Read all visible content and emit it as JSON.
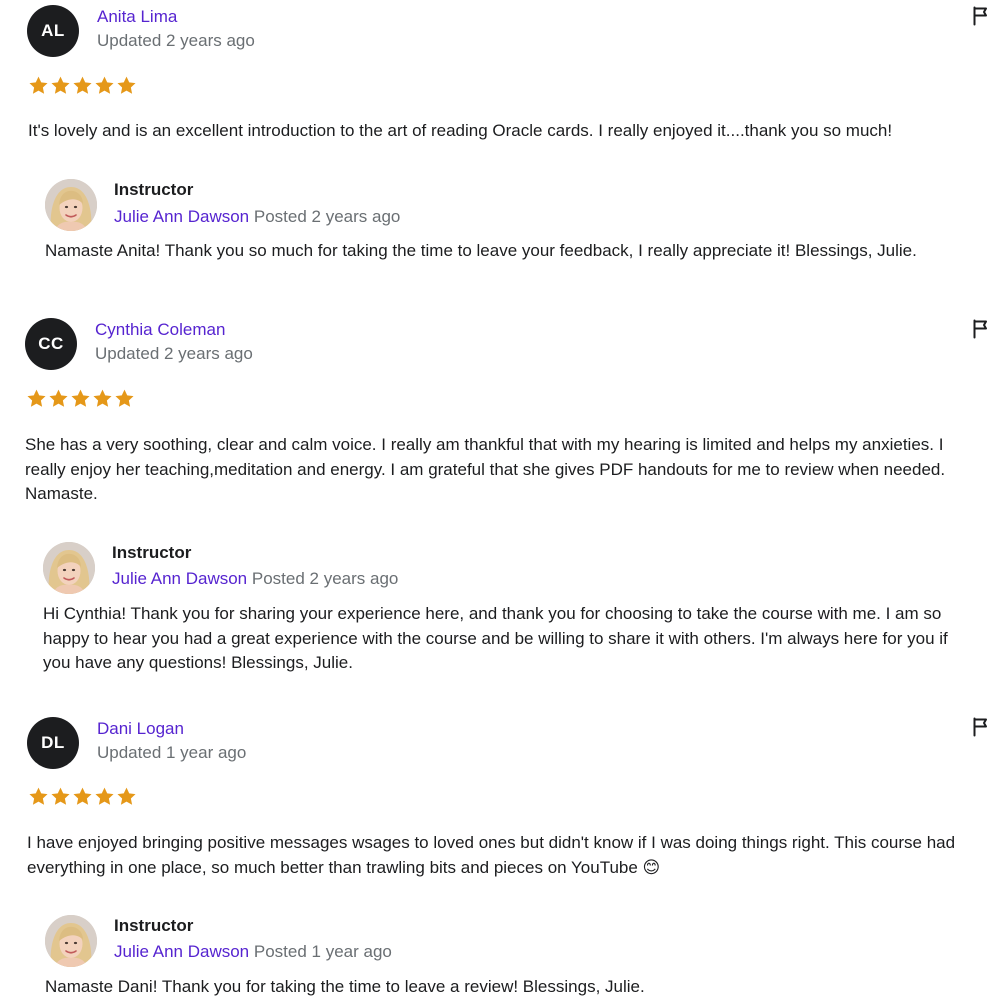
{
  "colors": {
    "accent": "#5624d0",
    "star": "#e59819",
    "muted": "#6a6f73",
    "text": "#1c1d1f"
  },
  "reviews": [
    {
      "initials": "AL",
      "name": "Anita Lima",
      "updated": "Updated 2 years ago",
      "rating": 5,
      "text": "It's lovely and is an excellent introduction to the art of reading Oracle cards. I really enjoyed it....thank you so much!",
      "response": {
        "label": "Instructor",
        "name": "Julie Ann Dawson",
        "posted": "Posted 2 years ago",
        "text": "Namaste Anita! Thank you so much for taking the time to leave your feedback, I really appreciate it! Blessings, Julie."
      }
    },
    {
      "initials": "CC",
      "name": "Cynthia Coleman",
      "updated": "Updated 2 years ago",
      "rating": 5,
      "text": "She has a very soothing, clear and calm voice. I really am thankful that with my hearing is limited and helps my anxieties. I really enjoy her teaching,meditation and energy. I am grateful that she gives PDF handouts for me to review when needed. Namaste.",
      "response": {
        "label": "Instructor",
        "name": "Julie Ann Dawson",
        "posted": "Posted 2 years ago",
        "text": "Hi Cynthia! Thank you for sharing your experience here, and thank you for choosing to take the course with me. I am so happy to hear you had a great experience with the course and be willing to share it with others. I'm always here for you if you have any questions! Blessings, Julie."
      }
    },
    {
      "initials": "DL",
      "name": "Dani Logan",
      "updated": "Updated 1 year ago",
      "rating": 5,
      "text": "I have enjoyed bringing positive messages wsages to loved ones but didn't know if I was doing things right. This course had everything in one place, so much better than trawling bits and pieces on YouTube 😊",
      "response": {
        "label": "Instructor",
        "name": "Julie Ann Dawson",
        "posted": "Posted 1 year ago",
        "text": "Namaste Dani! Thank you for taking the time to leave a review! Blessings, Julie."
      }
    }
  ]
}
